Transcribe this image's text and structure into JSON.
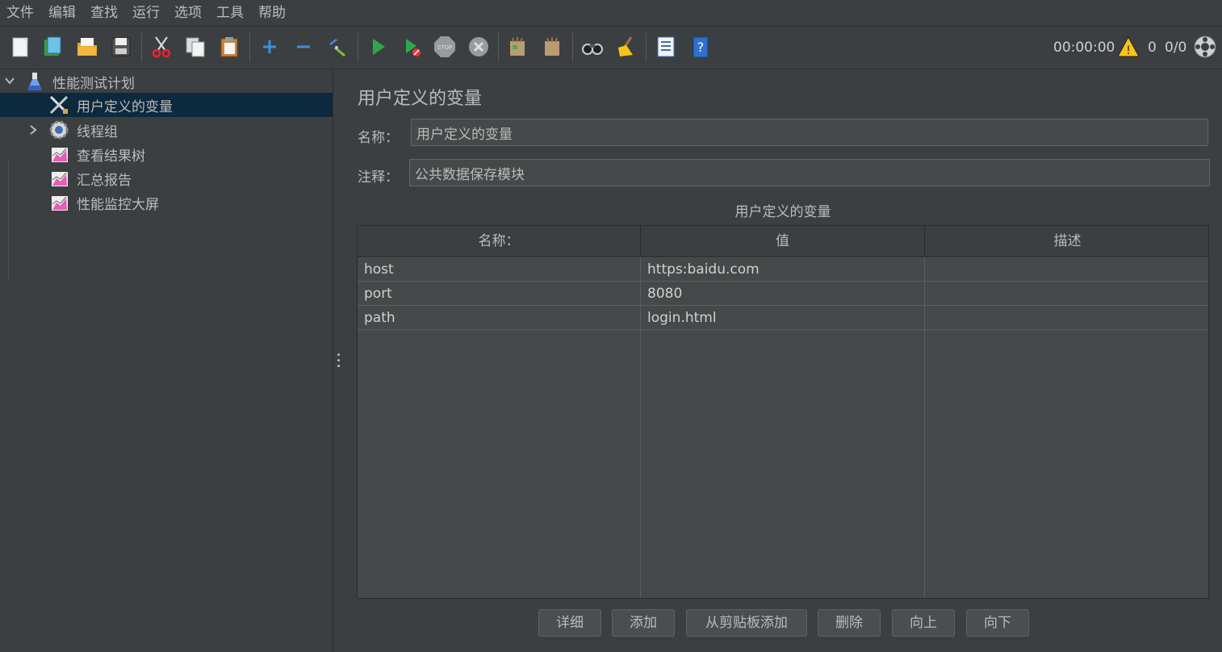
{
  "menu": [
    "文件",
    "编辑",
    "查找",
    "运行",
    "选项",
    "工具",
    "帮助"
  ],
  "toolbar": {
    "icons": [
      "new-icon",
      "templates-icon",
      "open-icon",
      "save-icon",
      "cut-icon",
      "copy-icon",
      "paste-icon",
      "expand-icon",
      "collapse-icon",
      "toggle-icon",
      "start-icon",
      "start-no-pause-icon",
      "stop-icon",
      "shutdown-icon",
      "clear-icon",
      "clear-all-icon",
      "search-icon",
      "reset-search-icon",
      "function-helper-icon",
      "help-icon"
    ],
    "timer": "00:00:00",
    "warning_count": "0",
    "thread_ratio": "0/0"
  },
  "tree": {
    "root": "性能测试计划",
    "items": [
      "用户定义的变量",
      "线程组",
      "查看结果树",
      "汇总报告",
      "性能监控大屏"
    ]
  },
  "panel": {
    "title": "用户定义的变量",
    "name_label": "名称：",
    "name_value": "用户定义的变量",
    "comment_label": "注释：",
    "comment_value": "公共数据保存模块",
    "table_caption": "用户定义的变量",
    "columns": [
      "名称：",
      "值",
      "描述"
    ],
    "rows": [
      [
        "host",
        "https:baidu.com",
        ""
      ],
      [
        "port",
        "8080",
        ""
      ],
      [
        "path",
        "login.html",
        ""
      ]
    ],
    "buttons": [
      "详细",
      "添加",
      "从剪贴板添加",
      "删除",
      "向上",
      "向下"
    ]
  },
  "colors": {
    "background": "#3c3f41",
    "selection": "#0d293e",
    "text": "#bbbbbb",
    "run_green": "#2ea84a",
    "warning_yellow": "#f5c518"
  }
}
